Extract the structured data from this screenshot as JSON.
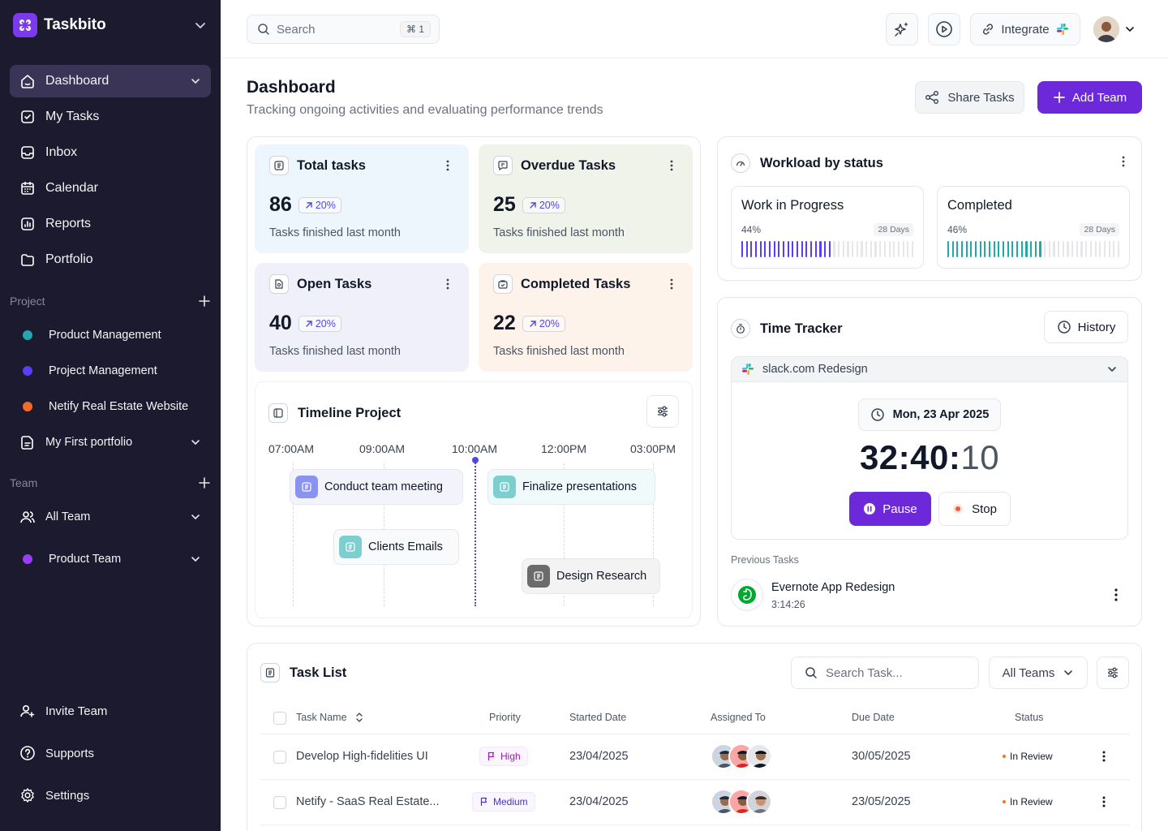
{
  "app": {
    "name": "Taskbito"
  },
  "sidebar": {
    "nav": [
      {
        "label": "Dashboard",
        "icon": "home-icon"
      },
      {
        "label": "My Tasks",
        "icon": "checkbox-icon"
      },
      {
        "label": "Inbox",
        "icon": "inbox-icon"
      },
      {
        "label": "Calendar",
        "icon": "calendar-icon"
      },
      {
        "label": "Reports",
        "icon": "bar-chart-icon"
      },
      {
        "label": "Portfolio",
        "icon": "folder-icon"
      }
    ],
    "project_heading": "Project",
    "projects": [
      {
        "label": "Product Management",
        "color": "#22a7b3"
      },
      {
        "label": "Project Management",
        "color": "#5b3df5"
      },
      {
        "label": "Netify Real Estate Website",
        "color": "#f26b2c"
      },
      {
        "label": "My First portfolio",
        "icon": "document-icon"
      }
    ],
    "team_heading": "Team",
    "teams": [
      {
        "label": "All Team",
        "icon": "users-icon"
      },
      {
        "label": "Product Team",
        "color": "#9a3df5"
      }
    ],
    "bottom": [
      {
        "label": "Invite Team",
        "icon": "user-plus-icon"
      },
      {
        "label": "Supports",
        "icon": "help-icon"
      },
      {
        "label": "Settings",
        "icon": "gear-icon"
      }
    ]
  },
  "topbar": {
    "search_placeholder": "Search",
    "search_shortcut": "⌘ 1",
    "integrate_label": "Integrate"
  },
  "header": {
    "title": "Dashboard",
    "subtitle": "Tracking ongoing activities and evaluating performance trends",
    "share_label": "Share Tasks",
    "add_label": "Add Team"
  },
  "stats": [
    {
      "title": "Total tasks",
      "value": "86",
      "change": "20%",
      "caption": "Tasks finished last month",
      "bg": "#eef6fd"
    },
    {
      "title": "Overdue Tasks",
      "value": "25",
      "change": "20%",
      "caption": "Tasks finished last month",
      "bg": "#f0f3ea"
    },
    {
      "title": "Open Tasks",
      "value": "40",
      "change": "20%",
      "caption": "Tasks finished last month",
      "bg": "#f0f0fa"
    },
    {
      "title": "Completed Tasks",
      "value": "22",
      "change": "20%",
      "caption": "Tasks finished last month",
      "bg": "#fdf3ea"
    }
  ],
  "timeline": {
    "title": "Timeline Project",
    "times": [
      "07:00AM",
      "09:00AM",
      "10:00AM",
      "12:00PM",
      "03:00PM"
    ],
    "tasks": [
      {
        "label": "Conduct team meeting",
        "color": "#8b93f0"
      },
      {
        "label": "Finalize presentations",
        "color": "#7dcfcf"
      },
      {
        "label": "Clients Emails",
        "color": "#7dcfcf"
      },
      {
        "label": "Design Research",
        "color": "#6b6b6b"
      }
    ]
  },
  "workload": {
    "title": "Workload by status",
    "cards": [
      {
        "title": "Work in Progress",
        "pct": "44%",
        "days": "28 Days",
        "fill": 0.44,
        "color": "#5b3df5"
      },
      {
        "title": "Completed",
        "pct": "46%",
        "days": "28 Days",
        "fill": 0.46,
        "color": "#1faaa6"
      }
    ]
  },
  "tracker": {
    "title": "Time Tracker",
    "history_label": "History",
    "project": "slack.com Redesign",
    "date": "Mon, 23 Apr 2025",
    "time_main": "32:40:",
    "time_sec": "10",
    "pause_label": "Pause",
    "stop_label": "Stop",
    "previous_label": "Previous Tasks",
    "previous": {
      "name": "Evernote App Redesign",
      "time": "3:14:26"
    }
  },
  "tasklist": {
    "title": "Task List",
    "search_placeholder": "Search Task...",
    "team_filter": "All Teams",
    "columns": [
      "Task Name",
      "Priority",
      "Started Date",
      "Assigned To",
      "Due Date",
      "Status"
    ],
    "rows": [
      {
        "name": "Develop High-fidelities UI",
        "priority": "High",
        "priority_color": "#a21caf",
        "started": "23/04/2025",
        "due": "30/05/2025",
        "status": "In Review"
      },
      {
        "name": "Netify - SaaS Real Estate...",
        "priority": "Medium",
        "priority_color": "#4338ca",
        "started": "23/04/2025",
        "due": "23/05/2025",
        "status": "In Review"
      }
    ]
  }
}
